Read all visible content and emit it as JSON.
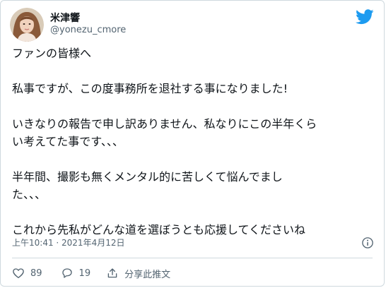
{
  "author": {
    "display_name": "米津響",
    "handle": "@yonezu_cmore"
  },
  "tweet": {
    "paragraphs": [
      "ファンの皆様へ",
      "私事ですが、この度事務所を退社する事になりました!",
      "いきなりの報告で申し訳ありません、私なりにこの半年くら\nい考えてた事です、、、",
      "半年間、撮影も無くメンタル的に苦しくて悩んでまし\nた、、、",
      "これから先私がどんな道を選ぼうとも応援してくださいね"
    ],
    "timestamp": "上午10:41 · 2021年4月12日"
  },
  "actions": {
    "like_count": "89",
    "reply_count": "19",
    "share_label": "分享此推文"
  },
  "colors": {
    "twitter_blue": "#1d9bf0",
    "secondary_text": "#536471",
    "border": "#cfd9de"
  },
  "icons": {
    "logo": "twitter-bird-icon",
    "info": "info-icon",
    "like": "heart-icon",
    "reply": "reply-bubble-icon",
    "share": "share-upload-icon"
  }
}
